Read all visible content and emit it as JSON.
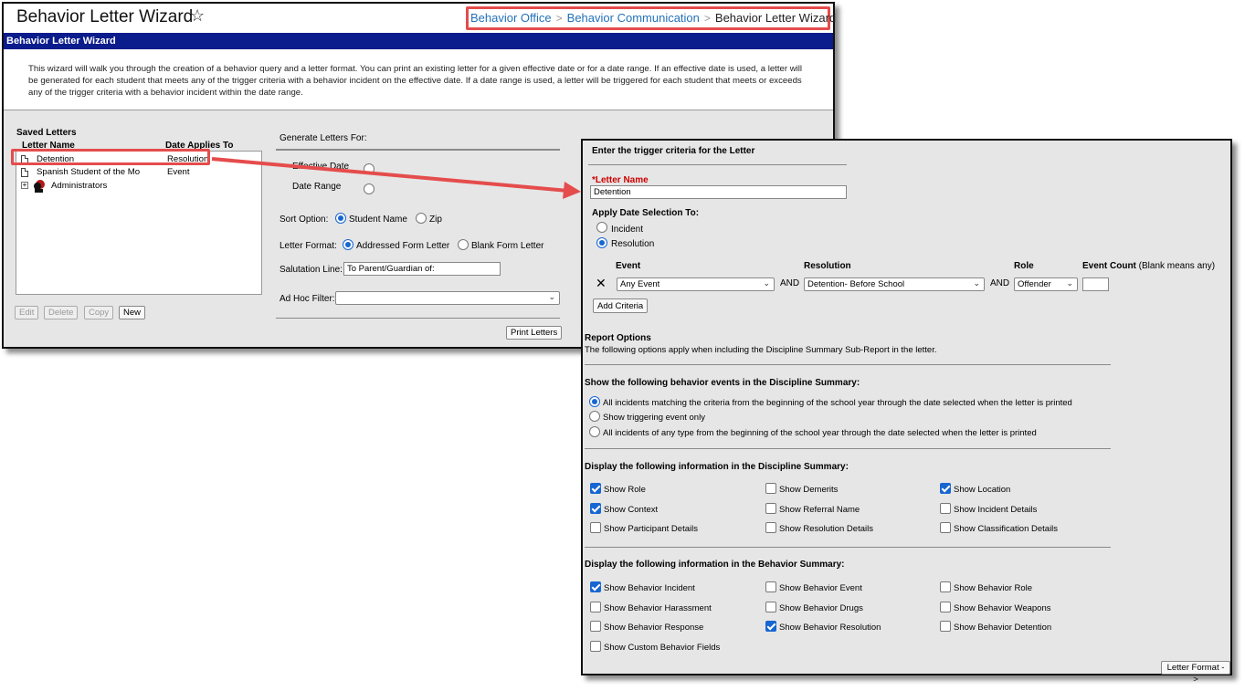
{
  "header": {
    "title": "Behavior Letter Wizard",
    "star_icon": "star-outline-icon",
    "breadcrumb": [
      "Behavior Office",
      "Behavior Communication",
      "Behavior Letter Wizard"
    ]
  },
  "wizard": {
    "bar_title": "Behavior Letter Wizard",
    "intro_line1": "This wizard will walk you through the creation of a behavior query and a letter format. You can print an existing letter for a given effective date or for a date range. If an effective date is used, a letter will",
    "intro_line2": "be generated for each student that meets any of the trigger criteria with a behavior incident on the effective date. If a date range is used, a letter will be triggered for each student that meets or exceeds",
    "intro_line3": "any of the trigger criteria with a behavior incident within the date range."
  },
  "saved_letters": {
    "title": "Saved Letters",
    "col_name": "Letter Name",
    "col_date": "Date Applies To",
    "rows": [
      {
        "name": "Detention",
        "applies": "Resolution"
      },
      {
        "name": "Spanish Student of the Mo",
        "applies": "Event"
      },
      {
        "name": "Administrators",
        "applies": ""
      }
    ],
    "buttons": {
      "edit": "Edit",
      "delete": "Delete",
      "copy": "Copy",
      "new": "New"
    }
  },
  "generate": {
    "title": "Generate Letters For:",
    "effective_date": "Effective Date",
    "date_range": "Date Range",
    "sort_label": "Sort Option:",
    "sort_student": "Student Name",
    "sort_zip": "Zip",
    "format_label": "Letter Format:",
    "format_addressed": "Addressed Form Letter",
    "format_blank": "Blank Form Letter",
    "salutation_label": "Salutation Line:",
    "salutation_value": "To Parent/Guardian of:",
    "adhoc_label": "Ad Hoc Filter:",
    "adhoc_value": "",
    "print_button": "Print Letters"
  },
  "criteria": {
    "title": "Enter the trigger criteria for the Letter",
    "letter_name_label": "*Letter Name",
    "letter_name_value": "Detention",
    "apply_label": "Apply Date Selection To:",
    "apply_incident": "Incident",
    "apply_resolution": "Resolution",
    "col_event": "Event",
    "col_resolution": "Resolution",
    "col_role": "Role",
    "col_count": "Event Count",
    "col_count_note": "(Blank means any)",
    "event_value": "Any Event",
    "and1": "AND",
    "resolution_value": "Detention- Before School",
    "and2": "AND",
    "role_value": "Offender",
    "count_value": "",
    "add_button": "Add Criteria"
  },
  "report_options": {
    "title": "Report Options",
    "desc": "The following options apply when including the Discipline Summary Sub-Report in the letter.",
    "events_title": "Show the following behavior events in the Discipline Summary:",
    "events_opt1": "All incidents matching the criteria from the beginning of the school year through the date selected when the letter is printed",
    "events_opt2": "Show triggering event only",
    "events_opt3": "All incidents of any type from the beginning of the school year through the date selected when the letter is printed",
    "disc_title": "Display the following information in the Discipline Summary:",
    "disc": [
      {
        "label": "Show Role",
        "checked": true
      },
      {
        "label": "Show Demerits",
        "checked": false
      },
      {
        "label": "Show Location",
        "checked": true
      },
      {
        "label": "Show Context",
        "checked": true
      },
      {
        "label": "Show Referral Name",
        "checked": false
      },
      {
        "label": "Show Incident Details",
        "checked": false
      },
      {
        "label": "Show Participant Details",
        "checked": false
      },
      {
        "label": "Show Resolution Details",
        "checked": false
      },
      {
        "label": "Show Classification Details",
        "checked": false
      }
    ],
    "beh_title": "Display the following information in the Behavior Summary:",
    "beh": [
      {
        "label": "Show Behavior Incident",
        "checked": true
      },
      {
        "label": "Show Behavior Event",
        "checked": false
      },
      {
        "label": "Show Behavior Role",
        "checked": false
      },
      {
        "label": "Show Behavior Harassment",
        "checked": false
      },
      {
        "label": "Show Behavior Drugs",
        "checked": false
      },
      {
        "label": "Show Behavior Weapons",
        "checked": false
      },
      {
        "label": "Show Behavior Response",
        "checked": false
      },
      {
        "label": "Show Behavior Resolution",
        "checked": true
      },
      {
        "label": "Show Behavior Detention",
        "checked": false
      },
      {
        "label": "Show Custom Behavior Fields",
        "checked": false
      }
    ],
    "next_button": "Letter Format ->"
  },
  "colors": {
    "nav_bar": "#0b1c8c",
    "link": "#2372b9",
    "highlight": "#e54c4c",
    "required": "#cc0000",
    "check": "#1766d1"
  }
}
